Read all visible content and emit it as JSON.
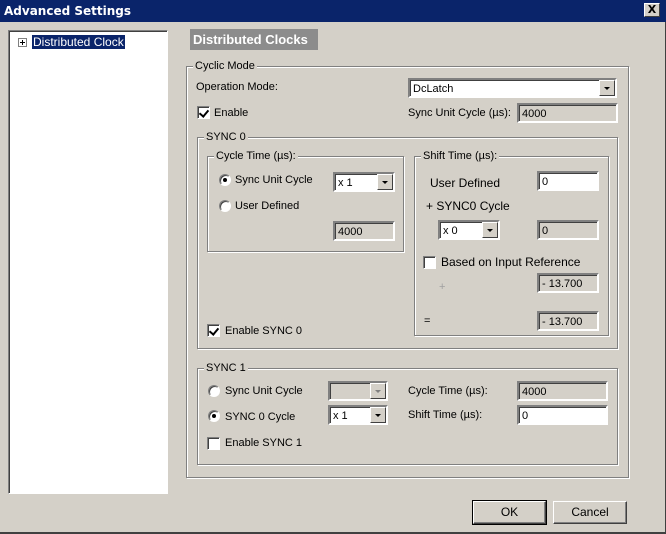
{
  "window": {
    "title": "Advanced Settings",
    "close_label": "X"
  },
  "tree": {
    "items": [
      {
        "label": "Distributed Clock",
        "selected": true
      }
    ]
  },
  "header": {
    "title": "Distributed Clocks"
  },
  "cyclic_mode": {
    "title": "Cyclic Mode",
    "operation_mode_label": "Operation Mode:",
    "operation_mode_value": "DcLatch",
    "enable_label": "Enable",
    "enable_checked": true,
    "sync_unit_cycle_label": "Sync Unit Cycle (µs):",
    "sync_unit_cycle_value": "4000"
  },
  "sync0": {
    "title": "SYNC 0",
    "cycle_time": {
      "title": "Cycle Time (µs):",
      "sync_unit_cycle_label": "Sync Unit Cycle",
      "sync_unit_cycle_selected": true,
      "multiplier_value": "x 1",
      "user_defined_label": "User Defined",
      "user_defined_selected": false,
      "value": "4000"
    },
    "shift_time": {
      "title": "Shift Time (µs):",
      "user_defined_label": "User Defined",
      "user_defined_value": "0",
      "sync0_cycle_label": "+ SYNC0 Cycle",
      "sync0_cycle_multiplier": "x 0",
      "sync0_cycle_value": "0",
      "based_on_input_label": "Based on Input Reference",
      "based_on_input_checked": false,
      "plus_label": "+",
      "input_ref_value": "- 13.700",
      "equals_label": "=",
      "total_value": "- 13.700"
    },
    "enable_label": "Enable SYNC 0",
    "enable_checked": true
  },
  "sync1": {
    "title": "SYNC 1",
    "sync_unit_cycle_label": "Sync Unit Cycle",
    "sync_unit_cycle_selected": false,
    "sync_unit_cycle_multiplier": "",
    "sync0_cycle_label": "SYNC 0 Cycle",
    "sync0_cycle_selected": true,
    "sync0_cycle_multiplier": "x 1",
    "cycle_time_label": "Cycle Time (µs):",
    "cycle_time_value": "4000",
    "shift_time_label": "Shift Time (µs):",
    "shift_time_value": "0",
    "enable_label": "Enable SYNC 1",
    "enable_checked": false
  },
  "buttons": {
    "ok": "OK",
    "cancel": "Cancel"
  }
}
